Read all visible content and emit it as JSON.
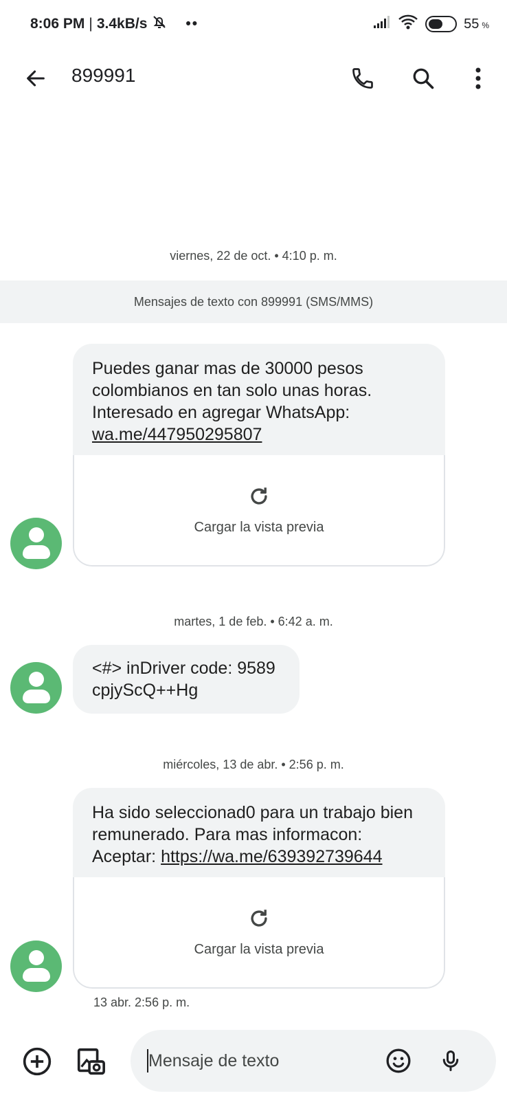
{
  "status_bar": {
    "time": "8:06 PM",
    "speed": "3.4kB/s",
    "battery_percent": "55",
    "battery_unit": "%",
    "battery_level": 0.55
  },
  "header": {
    "title": "899991",
    "icons": [
      "back-arrow-icon",
      "phone-icon",
      "search-icon",
      "more-vert-icon"
    ]
  },
  "conversation": {
    "banner": "Mensajes de texto con 899991 (SMS/MMS)",
    "messages": [
      {
        "date_separator": "viernes, 22 de oct. • 4:10 p. m.",
        "text": "Puedes ganar mas de 30000 pesos colombianos en tan solo unas horas. Interesado en agregar WhatsApp: ",
        "link": "wa.me/447950295807",
        "preview_label": "Cargar la vista previa"
      },
      {
        "date_separator": "martes, 1 de feb. • 6:42 a. m.",
        "text": "<#> inDriver code: 9589 cpjyScQ++Hg"
      },
      {
        "date_separator": "miércoles, 13 de abr. • 2:56 p. m.",
        "text": "Ha sido seleccionad0 para un trabajo bien remunerado. Para mas informacon: Aceptar: ",
        "link": "https://wa.me/639392739644",
        "preview_label": "Cargar la vista previa",
        "timestamp": "13 abr. 2:56 p. m."
      }
    ]
  },
  "compose": {
    "placeholder": "Mensaje de texto",
    "icons": [
      "add-circle-icon",
      "gallery-icon",
      "emoji-icon",
      "mic-icon"
    ]
  },
  "colors": {
    "avatar": "#5bb974",
    "bubble": "#f1f3f4",
    "banner": "#f1f3f4"
  }
}
